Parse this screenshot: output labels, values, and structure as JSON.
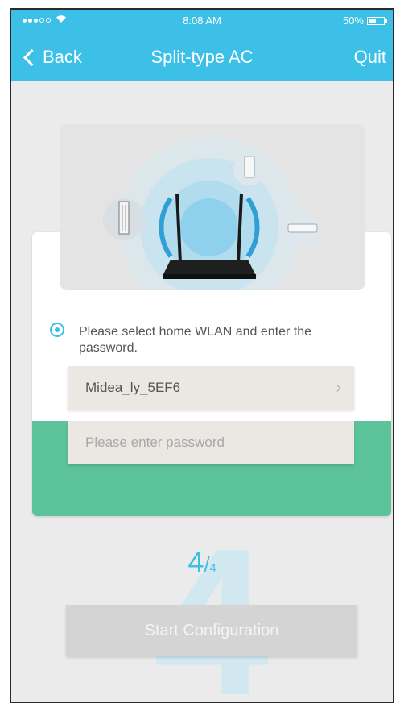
{
  "status_bar": {
    "time": "8:08 AM",
    "battery": "50%",
    "icons": [
      "signal-dots-icon",
      "wifi-icon",
      "battery-icon"
    ]
  },
  "nav": {
    "back_label": "Back",
    "title": "Split-type AC",
    "quit_label": "Quit"
  },
  "form": {
    "prompt": "Please select home WLAN and enter the password.",
    "wlan_value": "Midea_ly_5EF6",
    "password_placeholder": "Please enter password"
  },
  "step": {
    "current": "4",
    "separator": "/",
    "total": "4",
    "background_digit": "4"
  },
  "start_button_label": "Start Configuration",
  "colors": {
    "accent": "#3cc0e8",
    "band_green": "#5cc29a",
    "button_disabled": "#d4d4d4"
  }
}
